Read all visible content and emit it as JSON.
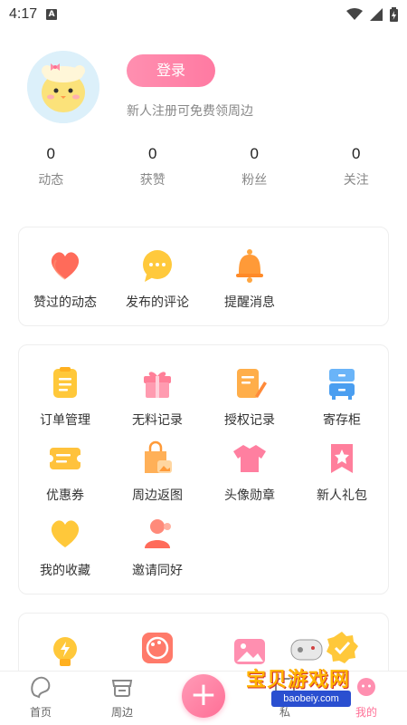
{
  "status_bar": {
    "time": "4:17",
    "notification_icon": "A"
  },
  "profile": {
    "login_label": "登录",
    "promo_text": "新人注册可免费领周边",
    "stats": [
      {
        "value": "0",
        "label": "动态"
      },
      {
        "value": "0",
        "label": "获赞"
      },
      {
        "value": "0",
        "label": "粉丝"
      },
      {
        "value": "0",
        "label": "关注"
      }
    ]
  },
  "activity": {
    "items": [
      {
        "label": "赞过的动态",
        "icon": "heart-icon"
      },
      {
        "label": "发布的评论",
        "icon": "comment-bubble-icon"
      },
      {
        "label": "提醒消息",
        "icon": "bell-icon"
      }
    ]
  },
  "services": {
    "items": [
      {
        "label": "订单管理",
        "icon": "clipboard-icon"
      },
      {
        "label": "无料记录",
        "icon": "gift-box-icon"
      },
      {
        "label": "授权记录",
        "icon": "document-edit-icon"
      },
      {
        "label": "寄存柜",
        "icon": "locker-icon"
      },
      {
        "label": "优惠券",
        "icon": "coupon-icon"
      },
      {
        "label": "周边返图",
        "icon": "shopping-bag-image-icon"
      },
      {
        "label": "头像勋章",
        "icon": "tshirt-icon"
      },
      {
        "label": "新人礼包",
        "icon": "star-bookmark-icon"
      },
      {
        "label": "我的收藏",
        "icon": "heart-favorite-icon"
      },
      {
        "label": "邀请同好",
        "icon": "invite-user-icon"
      }
    ]
  },
  "more": {
    "items": [
      {
        "icon": "lightbulb-icon"
      },
      {
        "icon": "palette-icon"
      },
      {
        "icon": "gallery-icon"
      },
      {
        "icon": "check-badge-icon"
      }
    ]
  },
  "bottom_nav": {
    "items": [
      {
        "label": "首页",
        "icon": "home-blob-icon"
      },
      {
        "label": "周边",
        "icon": "shop-icon"
      },
      {
        "label": "私",
        "icon": "message-icon"
      },
      {
        "label": "我的",
        "icon": "profile-icon"
      }
    ],
    "add_label": "+"
  },
  "watermark": {
    "title": "宝贝游戏网",
    "url": "baobeiy.com"
  },
  "colors": {
    "accent": "#ff7aa2",
    "orange": "#ffa640",
    "yellow": "#ffcd3c",
    "blue": "#5aa9f5"
  }
}
